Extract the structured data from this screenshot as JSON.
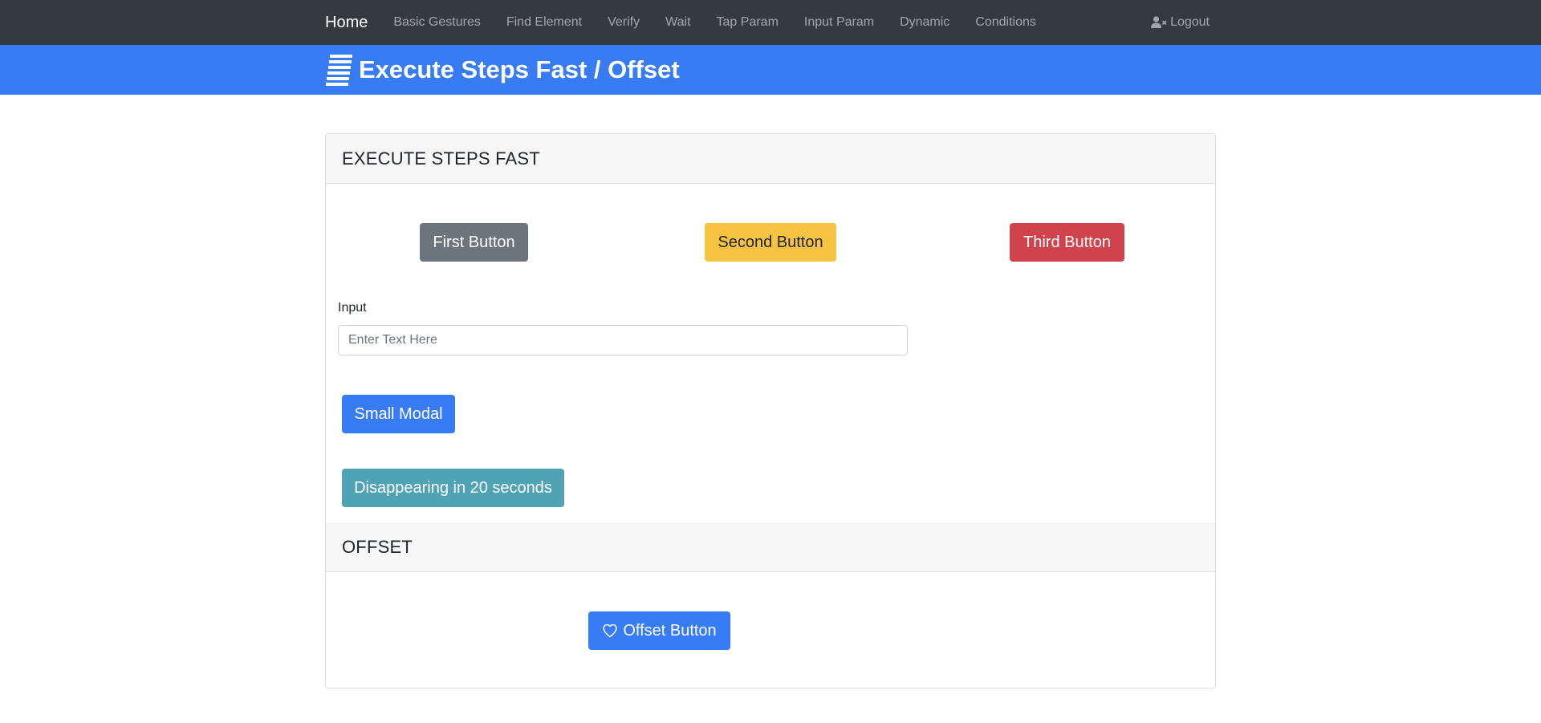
{
  "navbar": {
    "brand": "Home",
    "links": [
      "Basic Gestures",
      "Find Element",
      "Verify",
      "Wait",
      "Tap Param",
      "Input Param",
      "Dynamic",
      "Conditions"
    ],
    "logout_label": "Logout",
    "logout_icon": "user-x-icon",
    "background": "#343a40"
  },
  "hero": {
    "title": "Execute Steps Fast / Offset",
    "icon": "stack-lines-icon",
    "background": "#377bf5"
  },
  "section_fast": {
    "header": "EXECUTE STEPS FAST",
    "buttons": {
      "first": "First Button",
      "second": "Second Button",
      "third": "Third Button"
    },
    "input": {
      "label": "Input",
      "value": "",
      "placeholder": "Enter Text Here"
    },
    "small_modal_label": "Small Modal",
    "disappearing_label": "Disappearing in 20 seconds"
  },
  "section_offset": {
    "header": "OFFSET",
    "offset_button_label": "Offset Button",
    "offset_button_icon": "heart-outline-icon"
  },
  "colors": {
    "primary": "#377bf5",
    "secondary": "#6c757d",
    "warning": "#f6c343",
    "danger": "#d0434c",
    "info": "#4fa3b5"
  }
}
